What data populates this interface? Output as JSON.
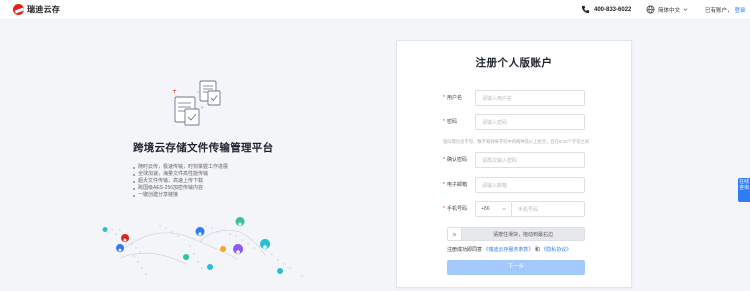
{
  "header": {
    "logo_text": "瑞迪云存",
    "phone": "400-833-6022",
    "language": "简体中文",
    "has_account": "已有账户，",
    "login": "登录"
  },
  "hero": {
    "title": "跨境云存储文件传输管理平台",
    "features": [
      "随时云传，极速传输，时刻掌握工作进展",
      "全球加速，海量文件高性能传输",
      "超大文件传输，高速上传下载",
      "跨国级AES-256加密传输内容",
      "一键创建分享链接"
    ]
  },
  "form": {
    "title": "注册个人版账户",
    "fields": {
      "username": {
        "label": "用户名",
        "placeholder": "请输入用户名"
      },
      "password": {
        "label": "密码",
        "placeholder": "请输入密码"
      },
      "confirm": {
        "label": "确认密码",
        "placeholder": "请再次输入密码"
      },
      "email": {
        "label": "电子邮箱",
        "placeholder": "请输入邮箱"
      },
      "phone": {
        "label": "手机号码",
        "country_code": "+86",
        "placeholder": "手机号码"
      }
    },
    "password_hint": "密码需包含字母，数字和特殊字符中的两种及以上组合，且在8-32个字符之间",
    "slider_text": "请按住滑块，拖动到最右边",
    "agree_prefix": "注册成功即同意",
    "terms_link": "《瑞迪云存服务条款》",
    "and": "和",
    "privacy_link": "《隐私协议》",
    "next_button": "下一步"
  },
  "sidetab": {
    "label": "在线咨询"
  }
}
